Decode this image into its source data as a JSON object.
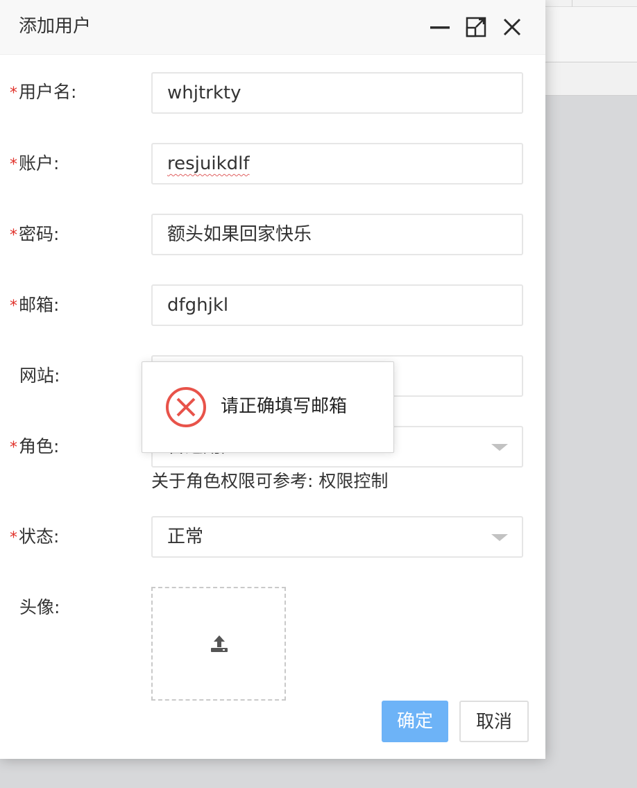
{
  "dialog": {
    "title": "添加用户",
    "controls": [
      "minimize-icon",
      "maximize-icon",
      "close-icon"
    ]
  },
  "form": {
    "required_mark": "*",
    "username": {
      "label": "用户名:",
      "value": "whjtrkty"
    },
    "account": {
      "label": "账户:",
      "value": "resjuikdlf"
    },
    "password": {
      "label": "密码:",
      "value": "额头如果回家快乐"
    },
    "email": {
      "label": "邮箱:",
      "value": "dfghjkl"
    },
    "website": {
      "label": "网站:",
      "value": ""
    },
    "role": {
      "label": "角色:",
      "value": "普通用户",
      "hint": "关于角色权限可参考: 权限控制"
    },
    "status": {
      "label": "状态:",
      "value": "正常"
    },
    "avatar": {
      "label": "头像:",
      "icon": "upload-icon"
    }
  },
  "buttons": {
    "ok": "确定",
    "cancel": "取消"
  },
  "toast": {
    "message": "请正确填写邮箱",
    "icon": "error-circle-icon"
  },
  "colors": {
    "required": "#e0312a",
    "primary_button": "#6db3f7",
    "error_icon": "#e8534a"
  }
}
